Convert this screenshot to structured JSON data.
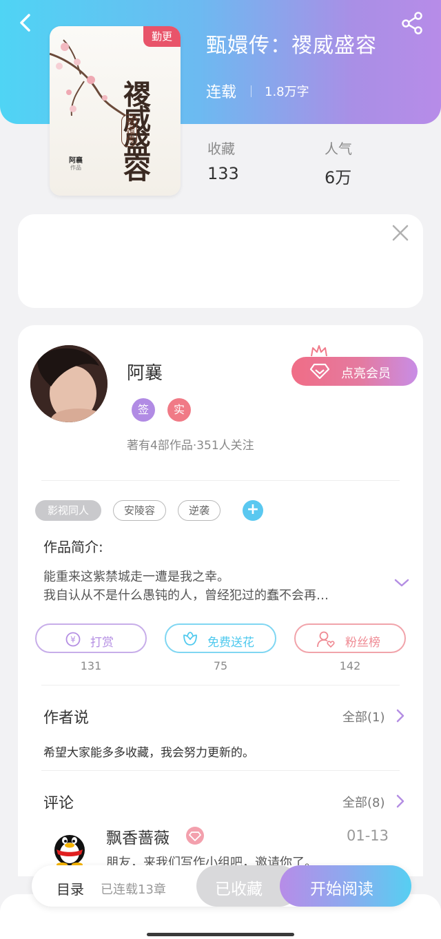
{
  "header": {
    "book_title": "甄嬛传：禝威盛容",
    "status": "连载",
    "word_count": "1.8万字",
    "stats": [
      {
        "label": "收藏",
        "value": "133"
      },
      {
        "label": "人气",
        "value": "6万"
      }
    ],
    "gradient_start": "#4fd4f4",
    "gradient_end": "#b78ce8"
  },
  "cover": {
    "badge": "勤更",
    "title": "禝威盛容",
    "subtitle": "甄嬛传",
    "author": "阿襄",
    "author_sub": "作品"
  },
  "author": {
    "name": "阿襄",
    "badges": [
      {
        "label": "签",
        "color": "#b18be4"
      },
      {
        "label": "实",
        "color": "#f07a86"
      }
    ],
    "meta": "著有4部作品·351人关注",
    "vip_button": "点亮会员"
  },
  "tags": [
    "影视同人",
    "安陵容",
    "逆袭"
  ],
  "intro": {
    "title": "作品简介:",
    "lines": [
      "能重来这紫禁城走一遭是我之幸。",
      "我自认从不是什么愚钝的人，曾经犯过的蠢不会再…"
    ]
  },
  "actions": [
    {
      "label": "打赏",
      "count": "131",
      "color": "#b48ee3"
    },
    {
      "label": "免费送花",
      "count": "75",
      "color": "#4fc9ee"
    },
    {
      "label": "粉丝榜",
      "count": "142",
      "color": "#ef8a93"
    }
  ],
  "author_says": {
    "title": "作者说",
    "all": "全部(1)",
    "text": "希望大家能多多收藏，我会努力更新的。"
  },
  "comments": {
    "title": "评论",
    "all": "全部(8)",
    "items": [
      {
        "user": "飘香蔷薇",
        "date": "01-13",
        "text": "朋友，来我们写作小组吧，邀请你了。"
      }
    ]
  },
  "bottom_bar": {
    "toc": "目录",
    "chapters": "已连载13章",
    "favorited": "已收藏",
    "start_reading": "开始阅读"
  }
}
